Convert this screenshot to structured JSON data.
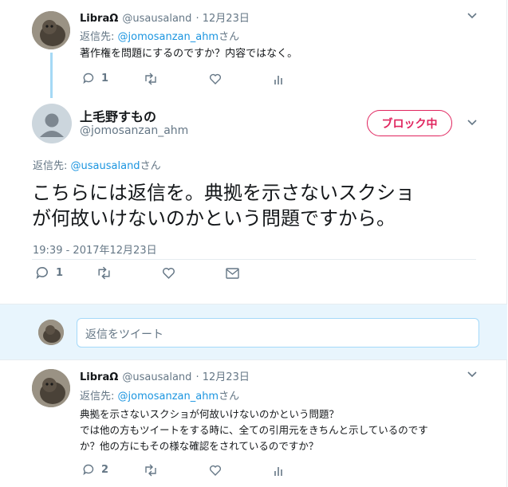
{
  "tweet1": {
    "display_name": "LibraΩ",
    "handle": "@usausaland",
    "date": "· 12月23日",
    "reply_to_prefix": "返信先:",
    "reply_to_handle": "@jomosanzan_ahm",
    "reply_to_suffix": "さん",
    "text": "著作権を問題にするのですか？内容ではなく。",
    "reply_count": "1"
  },
  "main_tweet": {
    "display_name": "上毛野すもの",
    "handle": "@jomosanzan_ahm",
    "block_label": "ブロック中",
    "reply_to_prefix": "返信先:",
    "reply_to_handle": "@usausaland",
    "reply_to_suffix": "さん",
    "text_line1": "こちらには返信を。典拠を示さないスクショ",
    "text_line2": "が何故いけないのかという問題ですから。",
    "timestamp": "19:39 - 2017年12月23日",
    "reply_count": "1"
  },
  "reply_box": {
    "placeholder": "返信をツイート"
  },
  "tweet2": {
    "display_name": "LibraΩ",
    "handle": "@usausaland",
    "date": "· 12月23日",
    "reply_to_prefix": "返信先:",
    "reply_to_handle": "@jomosanzan_ahm",
    "reply_to_suffix": "さん",
    "text_line1": "典拠を示さないスクショが何故いけないのかという問題？",
    "text_line2": "では他の方もツイートをする時に、全ての引用元をきちんと示しているのです",
    "text_line3": "か？他の方にもその様な確認をされているのですか？",
    "reply_count": "2"
  },
  "colors": {
    "accent": "#1b95e0",
    "block": "#e0245e",
    "muted": "#657786"
  }
}
